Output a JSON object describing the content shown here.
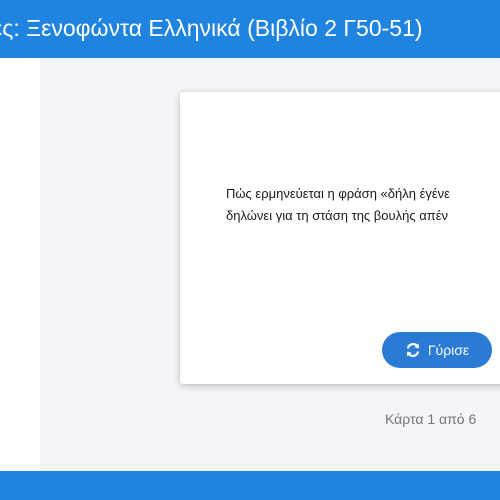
{
  "header": {
    "title": "ες: Ξενοφώντα Ελληνικά (Βιβλίο 2 Γ50-51)"
  },
  "card": {
    "question_line1": "Πώς ερμηνεύεται η φράση «δήλη έγένε",
    "question_line2": "δηλώνει για τη στάση της βουλής απέν",
    "flip_label": "Γύρισε",
    "flip_icon": "refresh-icon"
  },
  "counter": {
    "text": "Κάρτα 1 από 6"
  },
  "colors": {
    "header_bg": "#1e84e0",
    "button_bg": "#2a7bd4",
    "page_bg": "#f4f5f8"
  }
}
